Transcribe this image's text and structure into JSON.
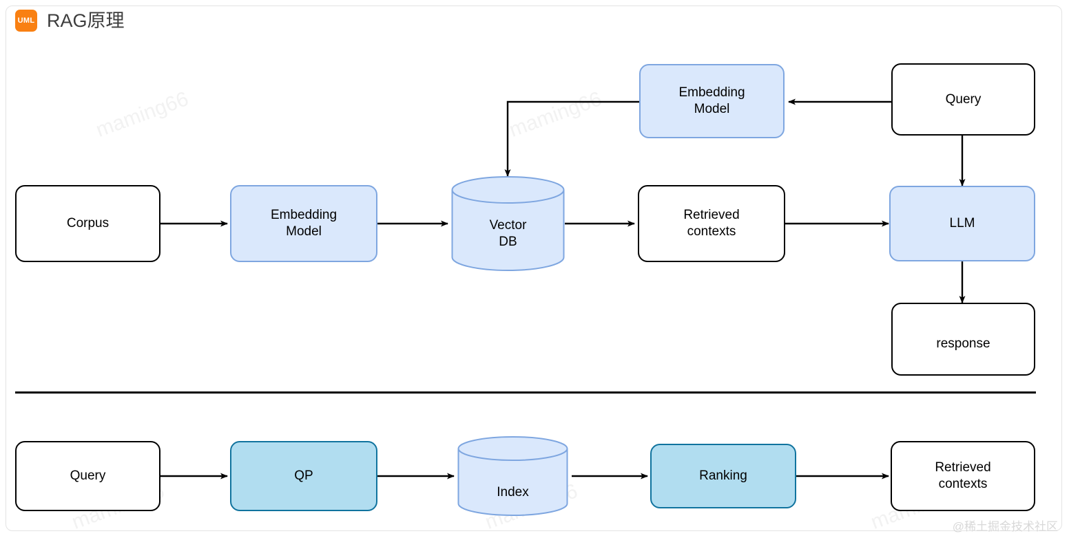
{
  "header": {
    "badge_label": "UML",
    "badge_color": "#f98012",
    "title": "RAG原理"
  },
  "palette": {
    "blue_fill": "#dae8fc",
    "blue_stroke": "#7ea6e0",
    "teal_fill": "#b1ddf0",
    "teal_stroke": "#10739e",
    "plain_fill": "#ffffff",
    "plain_stroke": "#000000",
    "edge_color": "#000000",
    "watermark_color": "#f2f2f2"
  },
  "diagram": {
    "type": "flowchart",
    "sections": [
      {
        "name": "rag-pipeline",
        "nodes": [
          {
            "id": "corpus",
            "label": "Corpus",
            "shape": "rounded-rect",
            "style": "plain"
          },
          {
            "id": "embedding-model",
            "label": "Embedding\nModel",
            "shape": "rounded-rect",
            "style": "blue"
          },
          {
            "id": "vector-db",
            "label": "Vector\nDB",
            "shape": "cylinder",
            "style": "blue"
          },
          {
            "id": "retrieved-contexts",
            "label": "Retrieved\ncontexts",
            "shape": "rounded-rect",
            "style": "plain"
          },
          {
            "id": "llm",
            "label": "LLM",
            "shape": "rounded-rect",
            "style": "blue"
          },
          {
            "id": "response",
            "label": "response",
            "shape": "rounded-rect",
            "style": "plain"
          },
          {
            "id": "query-top",
            "label": "Query",
            "shape": "rounded-rect",
            "style": "plain"
          },
          {
            "id": "embedding-model-query",
            "label": "Embedding\nModel",
            "shape": "rounded-rect",
            "style": "blue"
          }
        ],
        "edges": [
          {
            "from": "corpus",
            "to": "embedding-model"
          },
          {
            "from": "embedding-model",
            "to": "vector-db"
          },
          {
            "from": "vector-db",
            "to": "retrieved-contexts"
          },
          {
            "from": "retrieved-contexts",
            "to": "llm"
          },
          {
            "from": "llm",
            "to": "response"
          },
          {
            "from": "query-top",
            "to": "embedding-model-query"
          },
          {
            "from": "query-top",
            "to": "llm"
          },
          {
            "from": "embedding-model-query",
            "to": "vector-db"
          }
        ]
      },
      {
        "name": "retrieval-pipeline",
        "nodes": [
          {
            "id": "query-bottom",
            "label": "Query",
            "shape": "rounded-rect",
            "style": "plain"
          },
          {
            "id": "qp",
            "label": "QP",
            "shape": "rounded-rect",
            "style": "teal"
          },
          {
            "id": "index",
            "label": "Index",
            "shape": "cylinder",
            "style": "blue"
          },
          {
            "id": "ranking",
            "label": "Ranking",
            "shape": "rounded-rect",
            "style": "teal"
          },
          {
            "id": "retrieved-contexts-bottom",
            "label": "Retrieved\ncontexts",
            "shape": "rounded-rect",
            "style": "plain"
          }
        ],
        "edges": [
          {
            "from": "query-bottom",
            "to": "qp"
          },
          {
            "from": "qp",
            "to": "index"
          },
          {
            "from": "index",
            "to": "ranking"
          },
          {
            "from": "ranking",
            "to": "retrieved-contexts-bottom"
          }
        ]
      }
    ]
  },
  "labels": {
    "corpus": "Corpus",
    "embedding_model": "Embedding",
    "embedding_model_2": "Model",
    "vector_db_1": "Vector",
    "vector_db_2": "DB",
    "retrieved_1": "Retrieved",
    "retrieved_2": "contexts",
    "llm": "LLM",
    "response": "response",
    "query": "Query",
    "qp": "QP",
    "index": "Index",
    "ranking": "Ranking"
  },
  "watermarks": {
    "text": "maming66",
    "brand": "@稀土掘金技术社区"
  }
}
